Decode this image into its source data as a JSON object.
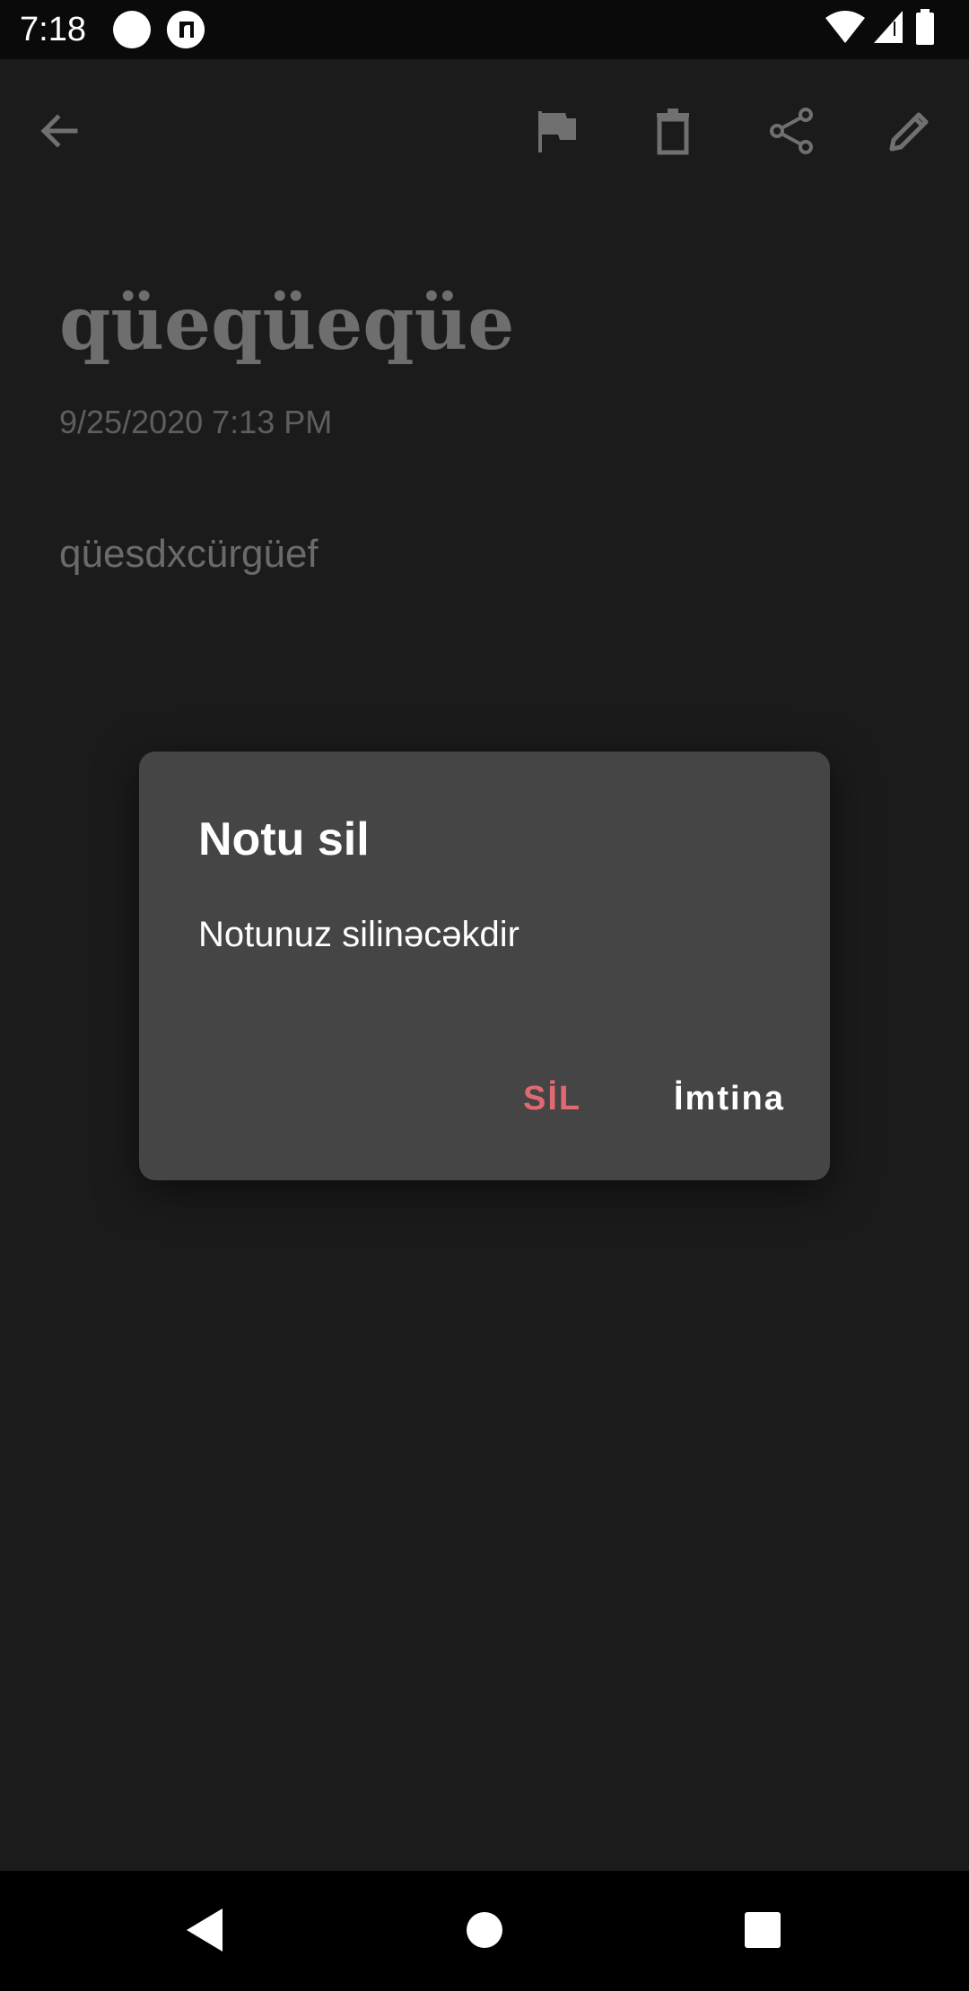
{
  "status_bar": {
    "time": "7:18",
    "icons": [
      "notification-dot-icon",
      "app-notification-icon",
      "wifi-icon",
      "cellular-signal-icon",
      "battery-icon"
    ]
  },
  "toolbar": {
    "icons": [
      "back-arrow-icon",
      "flag-icon",
      "delete-icon",
      "share-icon",
      "edit-icon"
    ]
  },
  "note": {
    "title": "qüeqüeqüe",
    "date": "9/25/2020 7:13 PM",
    "body": "qüesdxcürgüef"
  },
  "dialog": {
    "title": "Notu sil",
    "message": "Notunuz silinəcəkdir",
    "confirm_label": "SİL",
    "cancel_label": "İmtina"
  },
  "nav_bar": {
    "icons": [
      "nav-back-icon",
      "nav-home-icon",
      "nav-recents-icon"
    ]
  },
  "colors": {
    "background": "#1a1a1a",
    "dialog_background": "#454545",
    "destructive_accent": "#e06a6f",
    "dimmed_text": "#6e6e6e"
  }
}
